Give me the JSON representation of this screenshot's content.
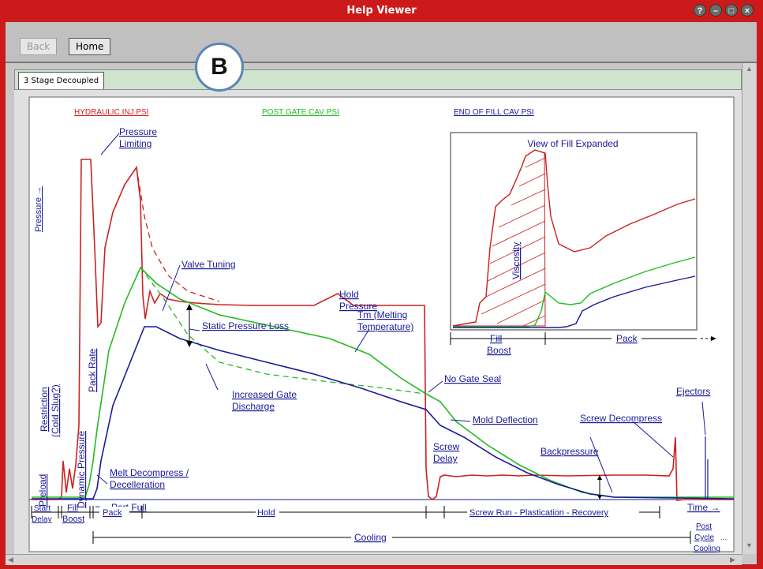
{
  "window": {
    "title": "Help Viewer",
    "buttons": [
      "?",
      "–",
      "□",
      "×"
    ]
  },
  "toolbar": {
    "back_label": "Back",
    "home_label": "Home"
  },
  "badge": {
    "label": "B"
  },
  "tabs": [
    {
      "label": "3 Stage Decoupled"
    }
  ],
  "diagram": {
    "series_labels": {
      "hydraulic": "HYDRAULIC INJ PSI",
      "post_gate": "POST GATE CAV PSI",
      "end_of_fill": "END OF FILL CAV PSI"
    },
    "pressure_axis": "Pressure →",
    "time_axis": "Time →",
    "inset_title": "View of Fill Expanded",
    "inset_viscosity": "Viscosity",
    "inset_fill": "Fill",
    "inset_boost": "Boost",
    "inset_pack": "Pack",
    "labels": {
      "pressure_limiting_1": "Pressure",
      "pressure_limiting_2": "Limiting",
      "valve_tuning": "Valve Tuning",
      "hold_pressure_1": "Hold",
      "hold_pressure_2": "Pressure",
      "static_pressure_loss": "Static Pressure Loss",
      "tm_1": "Tm  (Melting",
      "tm_2": "Temperature)",
      "increased_gate_1": "Increased Gate",
      "increased_gate_2": "Discharge",
      "no_gate_seal": "No Gate Seal",
      "mold_deflection": "Mold Deflection",
      "screw_delay_1": "Screw",
      "screw_delay_2": "Delay",
      "backpressure": "Backpressure",
      "screw_decompress": "Screw Decompress",
      "ejectors": "Ejectors",
      "melt_decompress_1": "Melt  Decompress /",
      "melt_decompress_2": "Decelleration",
      "part_full": "Part Full",
      "restriction_1": "Restriction",
      "restriction_2": "(Cold Slug?)",
      "pack_rate": "Pack Rate",
      "dynamic_pressure": "Dynamic Pressure",
      "preload": "Preload"
    },
    "phases": {
      "start": "Start",
      "delay": "Delay",
      "fill": "Fill",
      "boost": "Boost",
      "pack": "Pack",
      "hold": "Hold",
      "screw_run": "Screw Run - Plastication - Recovery",
      "cooling": "Cooling",
      "post": "Post",
      "cycle": "Cycle",
      "cooling2": "Cooling",
      "ellipsis": "..."
    }
  },
  "colors": {
    "hydraulic": "#cc2222",
    "post_gate": "#22bb22",
    "end_of_fill": "#1a1a99",
    "link": "#1a1a99",
    "frame": "#cc1a1a"
  }
}
